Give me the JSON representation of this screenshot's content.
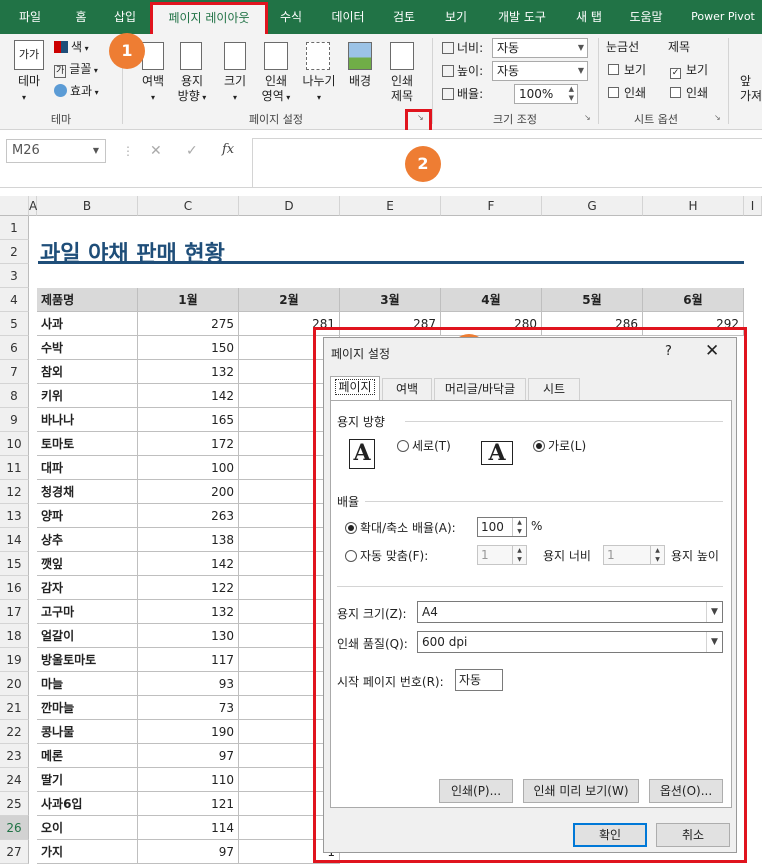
{
  "ribbon_tabs": [
    "파일",
    "홈",
    "삽입",
    "페이지 레이아웃",
    "수식",
    "데이터",
    "검토",
    "보기",
    "개발 도구",
    "새 탭",
    "도움말",
    "Power Pivot"
  ],
  "ribbon": {
    "theme": {
      "big_button": "테마",
      "icon_text": "가가",
      "colors": "색",
      "fonts": "글꼴",
      "effects": "효과",
      "group_label": "테마"
    },
    "page_setup": {
      "margins": "여백",
      "orientation_line1": "용지",
      "orientation_line2": "방향",
      "size": "크기",
      "print_area_line1": "인쇄",
      "print_area_line2": "영역",
      "breaks": "나누기",
      "background": "배경",
      "print_titles_line1": "인쇄",
      "print_titles_line2": "제목",
      "group_label": "페이지 설정"
    },
    "scale_to_fit": {
      "width_label": "너비:",
      "width_value": "자동",
      "height_label": "높이:",
      "height_value": "자동",
      "scale_label": "배율:",
      "scale_value": "100%",
      "group_label": "크기 조정"
    },
    "sheet_options": {
      "gridlines_title": "눈금선",
      "headings_title": "제목",
      "view": "보기",
      "print": "인쇄",
      "group_label": "시트 옵션"
    },
    "arrange_partial_line1": "앞",
    "arrange_partial_line2": "가져"
  },
  "formula_bar": {
    "name_box": "M26",
    "cancel": "✕",
    "enter": "✓",
    "fx": "fx",
    "value": ""
  },
  "callouts": [
    "1",
    "2",
    "3"
  ],
  "sheet": {
    "columns": [
      "A",
      "B",
      "C",
      "D",
      "E",
      "F",
      "G",
      "H",
      "I"
    ],
    "rows": [
      "1",
      "2",
      "3",
      "4",
      "5",
      "6",
      "7",
      "8",
      "9",
      "10",
      "11",
      "12",
      "13",
      "14",
      "15",
      "16",
      "17",
      "18",
      "19",
      "20",
      "21",
      "22",
      "23",
      "24",
      "25",
      "26",
      "27"
    ],
    "title": "과일 야채 판매 현황",
    "headers": [
      "제품명",
      "1월",
      "2월",
      "3월",
      "4월",
      "5월",
      "6월"
    ],
    "first_row": {
      "name": "사과",
      "values": [
        "275",
        "281",
        "287",
        "280",
        "286",
        "292"
      ]
    },
    "products": [
      {
        "name": "수박",
        "jan": "150",
        "feb": "1"
      },
      {
        "name": "참외",
        "jan": "132",
        "feb": "1"
      },
      {
        "name": "키위",
        "jan": "142",
        "feb": "1"
      },
      {
        "name": "바나나",
        "jan": "165",
        "feb": "1"
      },
      {
        "name": "토마토",
        "jan": "172",
        "feb": "1"
      },
      {
        "name": "대파",
        "jan": "100",
        "feb": "1"
      },
      {
        "name": "청경채",
        "jan": "200",
        "feb": "2"
      },
      {
        "name": "양파",
        "jan": "263",
        "feb": "2"
      },
      {
        "name": "상추",
        "jan": "138",
        "feb": "1"
      },
      {
        "name": "깻잎",
        "jan": "142",
        "feb": "1"
      },
      {
        "name": "감자",
        "jan": "122",
        "feb": "1"
      },
      {
        "name": "고구마",
        "jan": "132",
        "feb": "1"
      },
      {
        "name": "얼갈이",
        "jan": "130",
        "feb": "1"
      },
      {
        "name": "방울토마토",
        "jan": "117",
        "feb": "1"
      },
      {
        "name": "마늘",
        "jan": "93",
        "feb": ""
      },
      {
        "name": "깐마늘",
        "jan": "73",
        "feb": ""
      },
      {
        "name": "콩나물",
        "jan": "190",
        "feb": "1"
      },
      {
        "name": "메론",
        "jan": "97",
        "feb": "1"
      },
      {
        "name": "딸기",
        "jan": "110",
        "feb": "1"
      },
      {
        "name": "사과6입",
        "jan": "121",
        "feb": "1"
      },
      {
        "name": "오이",
        "jan": "114",
        "feb": "1"
      },
      {
        "name": "가지",
        "jan": "97",
        "feb": "1"
      }
    ]
  },
  "dialog": {
    "title": "페이지 설정",
    "help": "?",
    "close": "✕",
    "tabs": [
      "페이지",
      "여백",
      "머리글/바닥글",
      "시트"
    ],
    "orientation_section": "용지 방향",
    "portrait": "세로(T)",
    "landscape": "가로(L)",
    "orientation_icon": "A",
    "scaling_section": "배율",
    "adjust_to": "확대/축소 배율(A):",
    "adjust_value": "100",
    "percent": "%",
    "fit_to": "자동 맞춤(F):",
    "fit_wide_value": "1",
    "pages_wide": "용지 너비",
    "fit_tall_value": "1",
    "pages_tall": "용지 높이",
    "paper_size_label": "용지 크기(Z):",
    "paper_size": "A4",
    "print_quality_label": "인쇄 품질(Q):",
    "print_quality": "600 dpi",
    "first_page_label": "시작 페이지 번호(R):",
    "first_page": "자동",
    "print_btn": "인쇄(P)...",
    "preview_btn": "인쇄 미리 보기(W)",
    "options_btn": "옵션(O)...",
    "ok_btn": "확인",
    "cancel_btn": "취소"
  },
  "colors": {
    "excel_green": "#217346",
    "callout": "#ee7d33",
    "highlight": "#e0141e",
    "title_blue": "#1f4e79"
  }
}
